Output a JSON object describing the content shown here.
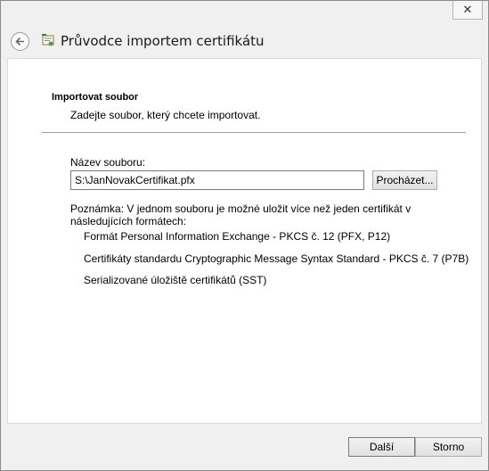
{
  "window": {
    "close_glyph": "✕"
  },
  "header": {
    "title": "Průvodce importem certifikátu",
    "back_icon": "back-arrow-icon",
    "app_icon": "certificate-wizard-icon"
  },
  "section": {
    "title": "Importovat soubor",
    "description": "Zadejte soubor, který chcete importovat."
  },
  "file": {
    "label": "Název souboru:",
    "value": "S:\\JanNovakCertifikat.pfx",
    "browse_label": "Procházet..."
  },
  "note": {
    "text": "Poznámka: V jednom souboru je možné uložit více než jeden certifikát v následujících formátech:",
    "formats": [
      "Formát Personal Information Exchange - PKCS č. 12 (PFX, P12)",
      "Certifikáty standardu Cryptographic Message Syntax Standard - PKCS č. 7 (P7B)",
      "Serializované úložiště certifikátů (SST)"
    ]
  },
  "footer": {
    "next_label": "Další",
    "cancel_label": "Storno"
  }
}
